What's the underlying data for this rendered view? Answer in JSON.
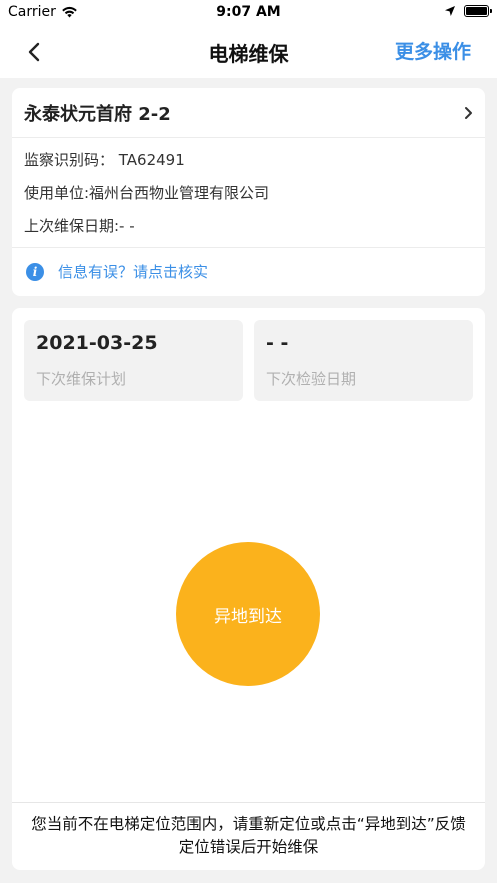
{
  "status_bar": {
    "carrier": "Carrier",
    "time": "9:07 AM"
  },
  "nav": {
    "title": "电梯维保",
    "more_label": "更多操作",
    "back_icon": "chevron-left-icon"
  },
  "elevator": {
    "name": "永泰状元首府  2-2",
    "supervision_code": "监察识别码：  TA62491",
    "user_unit": "使用单位:福州台西物业管理有限公司",
    "last_maintenance": "上次维保日期:- -",
    "verify_link": "信息有误？请点击核实"
  },
  "schedule": {
    "next_plan_value": "2021-03-25",
    "next_plan_label": "下次维保计划",
    "next_inspection_value": "- -",
    "next_inspection_label": "下次检验日期"
  },
  "action": {
    "arrive_button": "异地到达"
  },
  "notice": {
    "text": "您当前不在电梯定位范围内，请重新定位或点击“异地到达”反馈定位错误后开始维保"
  },
  "colors": {
    "accent": "#3b8fe6",
    "button": "#fbb21c"
  }
}
